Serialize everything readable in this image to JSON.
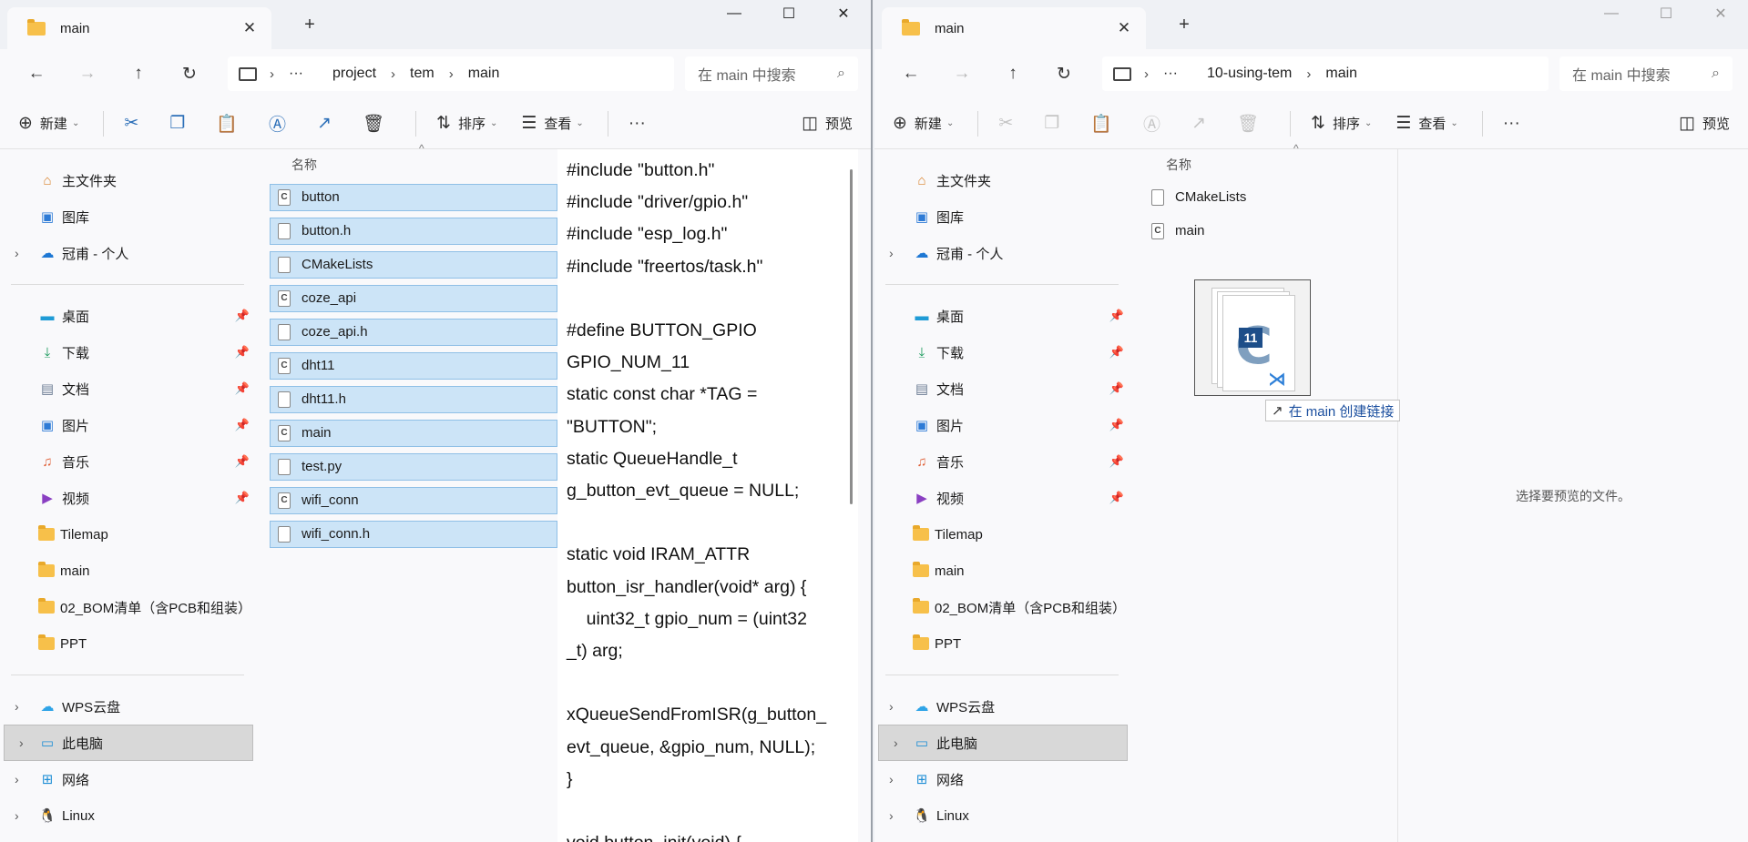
{
  "left": {
    "tab_title": "main",
    "breadcrumb": [
      "project",
      "tem",
      "main"
    ],
    "search_placeholder": "在 main 中搜索",
    "toolbar": {
      "new": "新建",
      "sort": "排序",
      "view": "查看",
      "preview": "预览"
    },
    "column_name": "名称",
    "files": [
      {
        "name": "button",
        "type": "c"
      },
      {
        "name": "button.h",
        "type": "h"
      },
      {
        "name": "CMakeLists",
        "type": "txt"
      },
      {
        "name": "coze_api",
        "type": "c"
      },
      {
        "name": "coze_api.h",
        "type": "h"
      },
      {
        "name": "dht11",
        "type": "c"
      },
      {
        "name": "dht11.h",
        "type": "h"
      },
      {
        "name": "main",
        "type": "c"
      },
      {
        "name": "test.py",
        "type": "py"
      },
      {
        "name": "wifi_conn",
        "type": "c"
      },
      {
        "name": "wifi_conn.h",
        "type": "h"
      }
    ],
    "code_lines": [
      "#include \"button.h\"",
      "#include \"driver/gpio.h\"",
      "#include \"esp_log.h\"",
      "#include \"freertos/task.h\"",
      "",
      "#define BUTTON_GPIO",
      "GPIO_NUM_11",
      "static const char *TAG =",
      "\"BUTTON\";",
      "static QueueHandle_t",
      "g_button_evt_queue = NULL;",
      "",
      "static void IRAM_ATTR",
      "button_isr_handler(void* arg) {",
      "    uint32_t gpio_num = (uint32",
      "_t) arg;",
      "",
      "xQueueSendFromISR(g_button_",
      "evt_queue, &gpio_num, NULL);",
      "}",
      "",
      "void button_init(void) {"
    ]
  },
  "right": {
    "tab_title": "main",
    "breadcrumb": [
      "10-using-tem",
      "main"
    ],
    "search_placeholder": "在 main 中搜索",
    "toolbar": {
      "new": "新建",
      "sort": "排序",
      "view": "查看",
      "preview": "预览"
    },
    "column_name": "名称",
    "files": [
      {
        "name": "CMakeLists",
        "type": "txt"
      },
      {
        "name": "main",
        "type": "c"
      }
    ],
    "preview_empty": "选择要预览的文件。",
    "drag_badge": "11",
    "drag_tooltip": "在 main 创建链接"
  },
  "nav": {
    "home": "主文件夹",
    "gallery": "图库",
    "onedrive": "冠甫 - 个人",
    "quick": [
      {
        "label": "桌面",
        "icon": "desktop-icon",
        "color": "#1f9bd6"
      },
      {
        "label": "下载",
        "icon": "download-icon",
        "color": "#1a9a5c"
      },
      {
        "label": "文档",
        "icon": "document-icon",
        "color": "#6b7c93"
      },
      {
        "label": "图片",
        "icon": "picture-icon",
        "color": "#2e7bd6"
      },
      {
        "label": "音乐",
        "icon": "music-icon",
        "color": "#e0623a"
      },
      {
        "label": "视频",
        "icon": "video-icon",
        "color": "#8a3fc2"
      }
    ],
    "folders": [
      "Tilemap",
      "main",
      "02_BOM清单（含PCB和组装）",
      "PPT"
    ],
    "wps": "WPS云盘",
    "this_pc": "此电脑",
    "network": "网络",
    "linux": "Linux"
  }
}
